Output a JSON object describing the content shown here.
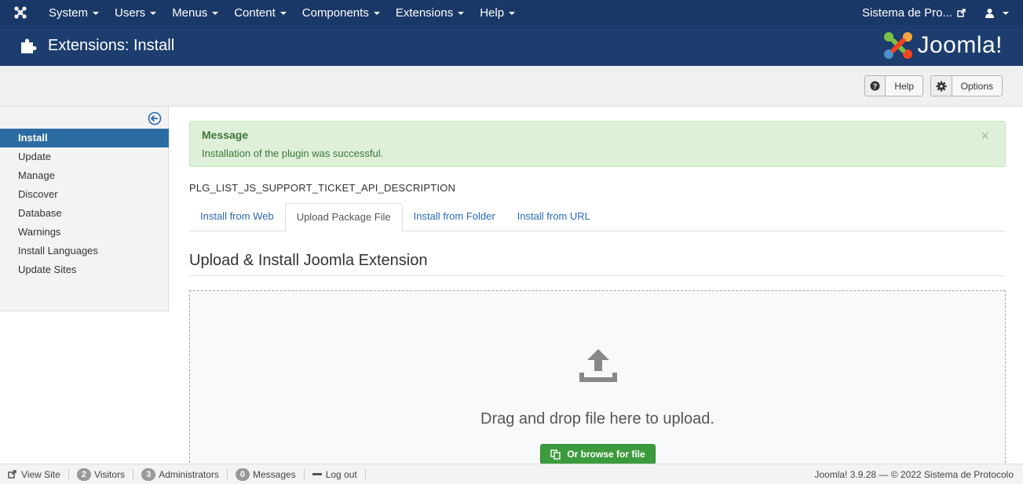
{
  "topnav": {
    "menu": [
      {
        "label": "System"
      },
      {
        "label": "Users"
      },
      {
        "label": "Menus"
      },
      {
        "label": "Content"
      },
      {
        "label": "Components"
      },
      {
        "label": "Extensions"
      },
      {
        "label": "Help"
      }
    ],
    "site_link": "Sistema de Pro...",
    "icons": {
      "logo": "joomla-logo-icon",
      "external": "external-link-icon",
      "user": "user-icon"
    }
  },
  "header": {
    "title": "Extensions: Install",
    "brand": "Joomla!",
    "icon": "puzzle-icon"
  },
  "toolbar": {
    "help_label": "Help",
    "options_label": "Options"
  },
  "sidebar": {
    "items": [
      {
        "label": "Install",
        "active": true
      },
      {
        "label": "Update"
      },
      {
        "label": "Manage"
      },
      {
        "label": "Discover"
      },
      {
        "label": "Database"
      },
      {
        "label": "Warnings"
      },
      {
        "label": "Install Languages"
      },
      {
        "label": "Update Sites"
      }
    ]
  },
  "message": {
    "heading": "Message",
    "text": "Installation of the plugin was successful.",
    "close": "×"
  },
  "description": "PLG_LIST_JS_SUPPORT_TICKET_API_DESCRIPTION",
  "tabs": [
    {
      "label": "Install from Web"
    },
    {
      "label": "Upload Package File",
      "active": true
    },
    {
      "label": "Install from Folder"
    },
    {
      "label": "Install from URL"
    }
  ],
  "upload": {
    "title": "Upload & Install Joomla Extension",
    "dropzone_text": "Drag and drop file here to upload.",
    "browse_label": "Or browse for file"
  },
  "statusbar": {
    "view_site": "View Site",
    "visitors_count": "2",
    "visitors_label": "Visitors",
    "admins_count": "3",
    "admins_label": "Administrators",
    "messages_count": "0",
    "messages_label": "Messages",
    "logout": "Log out",
    "copyright": "Joomla! 3.9.28 — © 2022 Sistema de Protocolo"
  },
  "colors": {
    "topnav_bg": "#1a3867",
    "header_bg": "#1c3d6e",
    "active_item": "#2d6ca2",
    "success_bg": "#dff0d8",
    "browse_btn": "#3c9b3d"
  }
}
